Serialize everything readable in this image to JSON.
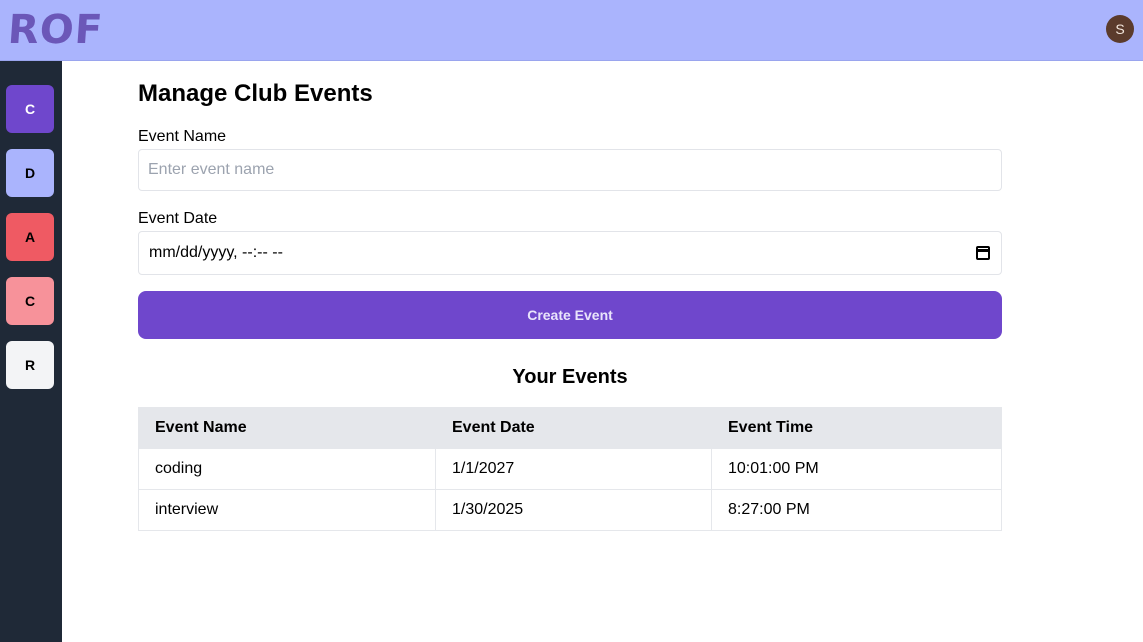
{
  "header": {
    "logo_text": "ROF",
    "avatar_initial": "S"
  },
  "sidebar": {
    "clubs": [
      {
        "letter": "C",
        "color": "#6f47cc",
        "text_color": "#ffffff"
      },
      {
        "letter": "D",
        "color": "#aab4fd",
        "text_color": "#000000"
      },
      {
        "letter": "A",
        "color": "#ef5a63",
        "text_color": "#000000"
      },
      {
        "letter": "C",
        "color": "#f7929a",
        "text_color": "#000000"
      },
      {
        "letter": "R",
        "color": "#f3f4f6",
        "text_color": "#000000"
      }
    ]
  },
  "main": {
    "title": "Manage Club Events",
    "event_name_label": "Event Name",
    "event_name_placeholder": "Enter event name",
    "event_date_label": "Event Date",
    "event_date_value": "mm/dd/yyyy, --:-- --",
    "create_button": "Create Event",
    "events_heading": "Your Events",
    "table": {
      "headers": [
        "Event Name",
        "Event Date",
        "Event Time"
      ],
      "rows": [
        [
          "coding",
          "1/1/2027",
          "10:01:00 PM"
        ],
        [
          "interview",
          "1/30/2025",
          "8:27:00 PM"
        ]
      ]
    }
  },
  "colors": {
    "topbar": "#aab4fd",
    "sidebar": "#1f2937",
    "accent": "#6f47cc"
  }
}
